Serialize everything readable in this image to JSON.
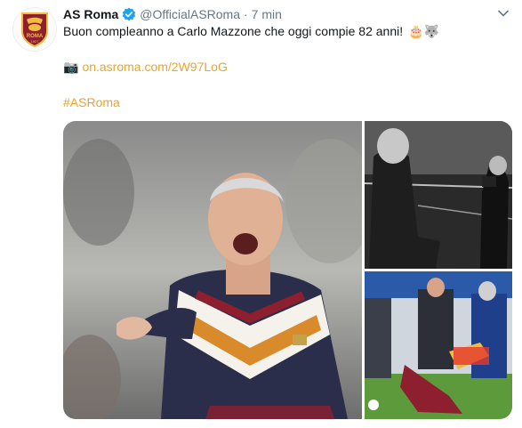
{
  "tweet": {
    "author_name": "AS Roma",
    "handle": "@OfficialASRoma",
    "separator": "·",
    "timestamp": "7 min",
    "text": "Buon compleanno a Carlo Mazzone che oggi compie 82 anni!",
    "emojis": "🎂🐺",
    "camera_emoji": "📷",
    "link_text": "on.asroma.com/2W97LoG",
    "hashtag": "#ASRoma"
  },
  "avatar": {
    "logo_text": "ROMA",
    "logo_year": "1927"
  },
  "colors": {
    "link": "#e8a42d",
    "verified": "#1da1f2",
    "secondary_text": "#657786",
    "roma_red": "#8e1f2f",
    "roma_gold": "#f0bc42"
  },
  "icons": [
    "verified-icon",
    "chevron-down-icon",
    "camera-icon"
  ]
}
